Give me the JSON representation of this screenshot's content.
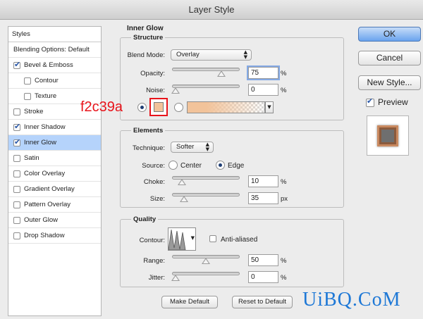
{
  "window": {
    "title": "Layer Style"
  },
  "sidebar": {
    "header": "Styles",
    "items": [
      {
        "label": "Blending Options: Default",
        "has_checkbox": false,
        "checked": false,
        "indent": 0,
        "selected": false
      },
      {
        "label": "Bevel & Emboss",
        "has_checkbox": true,
        "checked": true,
        "indent": 0,
        "selected": false
      },
      {
        "label": "Contour",
        "has_checkbox": true,
        "checked": false,
        "indent": 1,
        "selected": false
      },
      {
        "label": "Texture",
        "has_checkbox": true,
        "checked": false,
        "indent": 1,
        "selected": false
      },
      {
        "label": "Stroke",
        "has_checkbox": true,
        "checked": false,
        "indent": 0,
        "selected": false
      },
      {
        "label": "Inner Shadow",
        "has_checkbox": true,
        "checked": true,
        "indent": 0,
        "selected": false
      },
      {
        "label": "Inner Glow",
        "has_checkbox": true,
        "checked": true,
        "indent": 0,
        "selected": true
      },
      {
        "label": "Satin",
        "has_checkbox": true,
        "checked": false,
        "indent": 0,
        "selected": false
      },
      {
        "label": "Color Overlay",
        "has_checkbox": true,
        "checked": false,
        "indent": 0,
        "selected": false
      },
      {
        "label": "Gradient Overlay",
        "has_checkbox": true,
        "checked": false,
        "indent": 0,
        "selected": false
      },
      {
        "label": "Pattern Overlay",
        "has_checkbox": true,
        "checked": false,
        "indent": 0,
        "selected": false
      },
      {
        "label": "Outer Glow",
        "has_checkbox": true,
        "checked": false,
        "indent": 0,
        "selected": false
      },
      {
        "label": "Drop Shadow",
        "has_checkbox": true,
        "checked": false,
        "indent": 0,
        "selected": false
      }
    ]
  },
  "panel": {
    "title": "Inner Glow",
    "structure": {
      "label": "Structure",
      "blend_mode_label": "Blend Mode:",
      "blend_mode_value": "Overlay",
      "opacity_label": "Opacity:",
      "opacity_value": "75",
      "opacity_level": 0.75,
      "opacity_unit": "%",
      "noise_label": "Noise:",
      "noise_value": "0",
      "noise_level": 0,
      "noise_unit": "%",
      "color_annotation": "f2c39a",
      "glow_color": "#f2c39a"
    },
    "elements": {
      "label": "Elements",
      "technique_label": "Technique:",
      "technique_value": "Softer",
      "source_label": "Source:",
      "source_center": "Center",
      "source_edge": "Edge",
      "choke_label": "Choke:",
      "choke_value": "10",
      "choke_level": 0.1,
      "choke_unit": "%",
      "size_label": "Size:",
      "size_value": "35",
      "size_level": 0.14,
      "size_unit": "px"
    },
    "quality": {
      "label": "Quality",
      "contour_label": "Contour:",
      "anti_aliased": "Anti-aliased",
      "range_label": "Range:",
      "range_value": "50",
      "range_level": 0.5,
      "range_unit": "%",
      "jitter_label": "Jitter:",
      "jitter_value": "0",
      "jitter_level": 0,
      "jitter_unit": "%"
    },
    "make_default": "Make Default",
    "reset_default": "Reset to Default"
  },
  "actions": {
    "ok": "OK",
    "cancel": "Cancel",
    "new_style": "New Style...",
    "preview": "Preview"
  },
  "watermark": "UiBQ.CoM",
  "colors": {
    "annotation_red": "#e8141b",
    "selection": "#b5d3fb",
    "watermark_blue": "#1e78d6"
  }
}
